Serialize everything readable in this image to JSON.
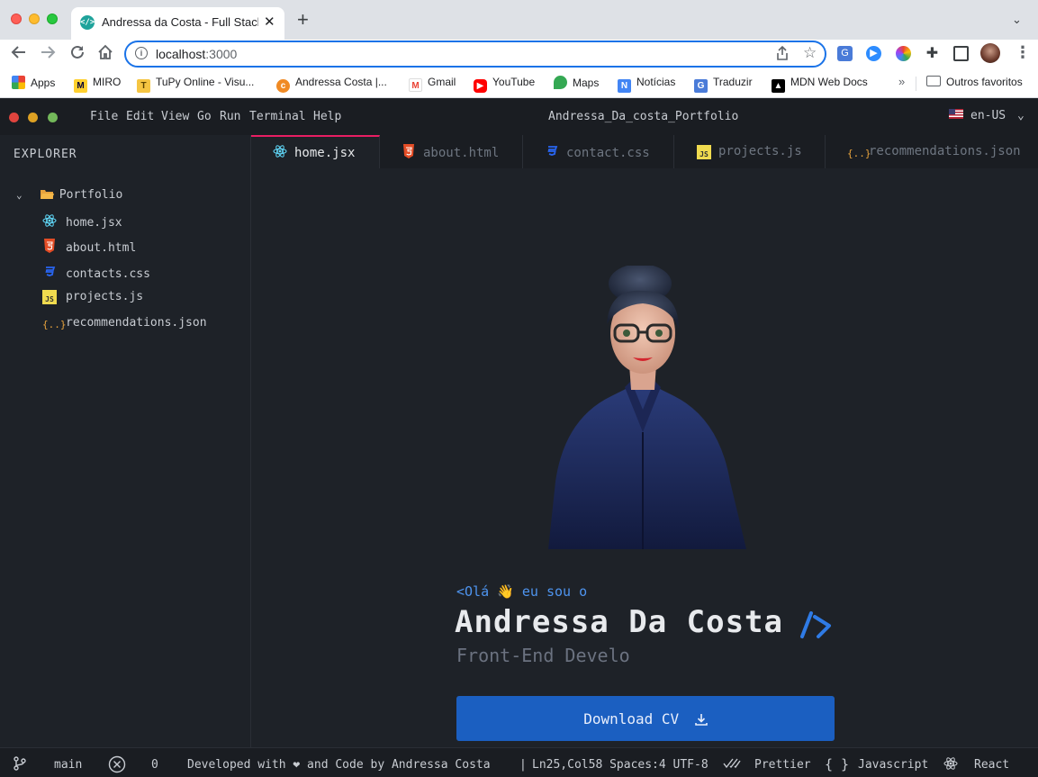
{
  "browser": {
    "tab_title": "Andressa da Costa - Full Stack Developer",
    "tab_favicon": "code-brackets-icon",
    "url": "localhost:3000",
    "url_host": "localhost",
    "url_port": ":3000",
    "bookmarks": [
      {
        "label": "Apps",
        "icon": "apps-grid-icon"
      },
      {
        "label": "MIRO",
        "icon": "miro-icon"
      },
      {
        "label": "TuPy Online - Visu...",
        "icon": "tupy-icon"
      },
      {
        "label": "Andressa Costa |...",
        "icon": "andressa-icon"
      },
      {
        "label": "Gmail",
        "icon": "gmail-icon"
      },
      {
        "label": "YouTube",
        "icon": "youtube-icon"
      },
      {
        "label": "Maps",
        "icon": "maps-icon"
      },
      {
        "label": "Notícias",
        "icon": "news-icon"
      },
      {
        "label": "Traduzir",
        "icon": "translate-icon"
      },
      {
        "label": "MDN Web Docs",
        "icon": "mdn-icon"
      }
    ],
    "bookmarks_overflow": "»",
    "other_bookmarks": "Outros favoritos"
  },
  "app": {
    "menu": [
      "File",
      "Edit",
      "View",
      "Go",
      "Run",
      "Terminal",
      "Help"
    ],
    "title": "Andressa_Da_costa_Portfolio",
    "language": "en-US",
    "explorer_title": "EXPLORER",
    "folder_name": "Portfolio",
    "files": [
      {
        "name": "home.jsx",
        "icon": "react-icon"
      },
      {
        "name": "about.html",
        "icon": "html5-icon"
      },
      {
        "name": "contacts.css",
        "icon": "css3-icon"
      },
      {
        "name": "projects.js",
        "icon": "javascript-icon"
      },
      {
        "name": "recommendations.json",
        "icon": "json-icon"
      }
    ],
    "tabs": [
      {
        "name": "home.jsx",
        "icon": "react-icon",
        "active": true
      },
      {
        "name": "about.html",
        "icon": "html5-icon"
      },
      {
        "name": "contact.css",
        "icon": "css3-icon"
      },
      {
        "name": "projects.js",
        "icon": "javascript-icon"
      },
      {
        "name": "recommendations.json",
        "icon": "json-icon"
      }
    ]
  },
  "hero": {
    "greeting": "<Olá 👋 eu sou o",
    "name": "Andressa Da Costa",
    "role": "Front-End Develo",
    "download_label": "Download CV"
  },
  "status": {
    "branch": "main",
    "errors": "0",
    "credit": "Developed with ❤ and Code by Andressa Costa",
    "position": "Ln25,Col58 Spaces:4 UTF-8",
    "formatter": "Prettier",
    "language": "Javascript",
    "framework": "React"
  },
  "colors": {
    "accent_blue": "#1b5fc1",
    "active_tab_border": "#e91e63",
    "greeting_blue": "#4e94ef",
    "editor_bg": "#1e2228"
  }
}
